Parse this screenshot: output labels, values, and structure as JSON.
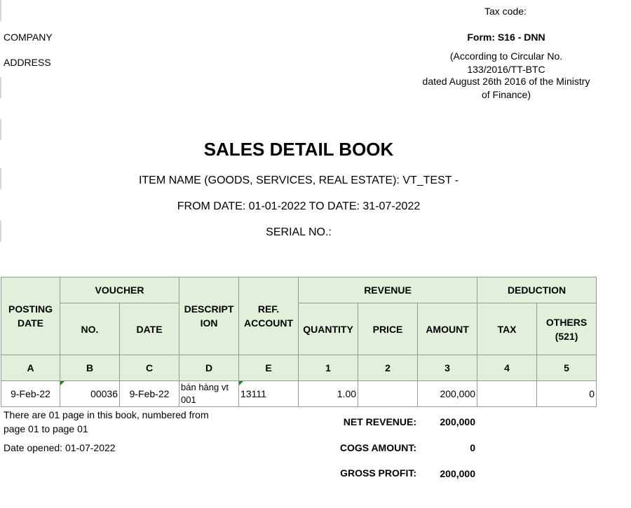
{
  "header": {
    "tax_code": "Tax code:",
    "company": "COMPANY",
    "address": "ADDRESS",
    "form": "Form: S16 - DNN",
    "circular_1": "(According to Circular No.",
    "circular_2": "133/2016/TT-BTC",
    "circular_3": "dated August 26th 2016 of the Ministry",
    "circular_4": "of Finance)"
  },
  "title": "SALES DETAIL BOOK",
  "item_name": "ITEM NAME (GOODS, SERVICES, REAL ESTATE): VT_TEST -",
  "date_range": "FROM DATE: 01-01-2022 TO DATE: 31-07-2022",
  "serial": "SERIAL NO.:",
  "table": {
    "headers": {
      "posting_date": "POSTING DATE",
      "voucher": "VOUCHER",
      "no": "NO.",
      "date": "DATE",
      "description": "DESCRIPT ION",
      "ref_account": "REF. ACCOUNT",
      "revenue": "REVENUE",
      "quantity": "QUANTITY",
      "price": "PRICE",
      "amount": "AMOUNT",
      "deduction": "DEDUCTION",
      "tax": "TAX",
      "others": "OTHERS (521)"
    },
    "letters": [
      "A",
      "B",
      "C",
      "D",
      "E",
      "1",
      "2",
      "3",
      "4",
      "5"
    ],
    "row": {
      "posting_date": "9-Feb-22",
      "no": "00036",
      "date": "9-Feb-22",
      "description": "bán hàng vt 001",
      "ref_account": "13111",
      "quantity": "1.00",
      "price": "",
      "amount": "200,000",
      "tax": "",
      "others": "0"
    }
  },
  "footer": {
    "pages_note_1": "There are 01 page in this book, numbered from",
    "pages_note_2": "page 01 to page 01",
    "date_opened": "Date opened:  01-07-2022"
  },
  "summary": {
    "net_revenue_label": "NET REVENUE:",
    "net_revenue_value": "200,000",
    "cogs_label": "COGS AMOUNT:",
    "cogs_value": "0",
    "gross_profit_label": "GROSS PROFIT:",
    "gross_profit_value": "200,000"
  }
}
